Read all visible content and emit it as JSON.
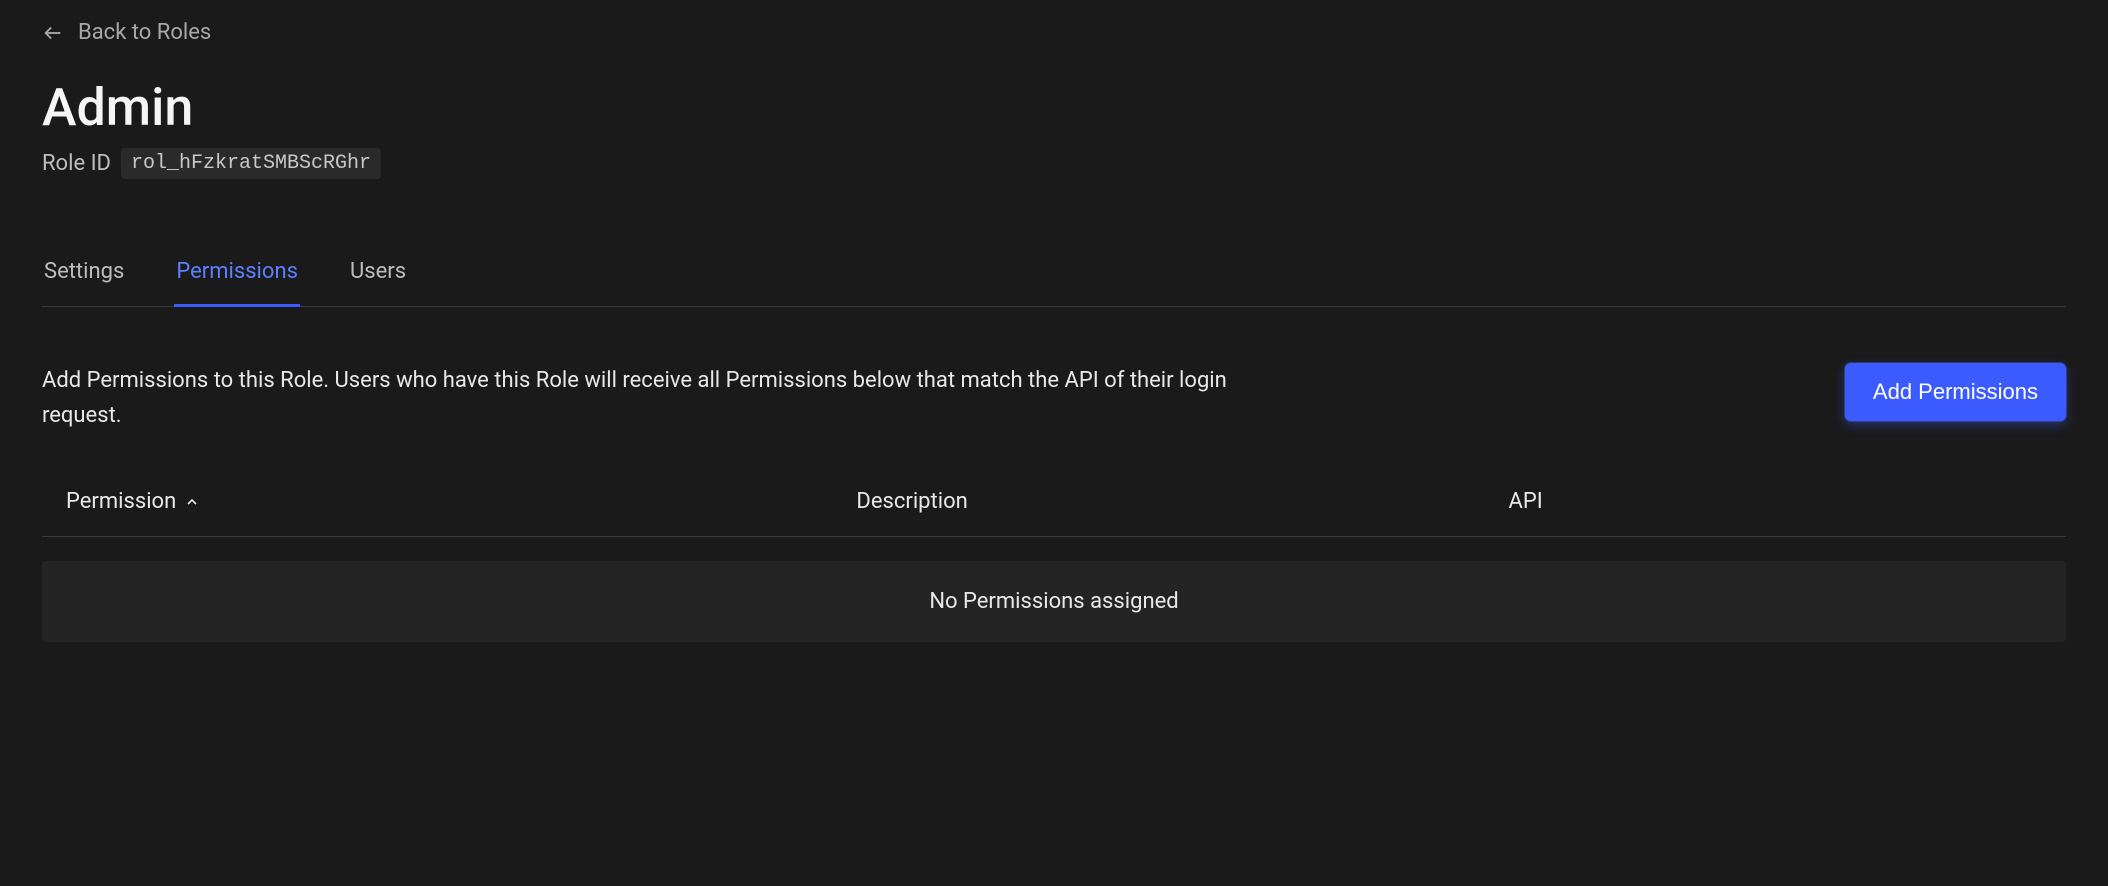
{
  "header": {
    "back_label": "Back to Roles",
    "title": "Admin",
    "role_id_label": "Role ID",
    "role_id_value": "rol_hFzkratSMBScRGhr"
  },
  "tabs": [
    {
      "label": "Settings",
      "active": false
    },
    {
      "label": "Permissions",
      "active": true
    },
    {
      "label": "Users",
      "active": false
    }
  ],
  "content": {
    "description": "Add Permissions to this Role. Users who have this Role will receive all Permissions below that match the API of their login request.",
    "add_button_label": "Add Permissions"
  },
  "table": {
    "columns": {
      "permission": "Permission",
      "description": "Description",
      "api": "API"
    },
    "empty_message": "No Permissions assigned"
  }
}
